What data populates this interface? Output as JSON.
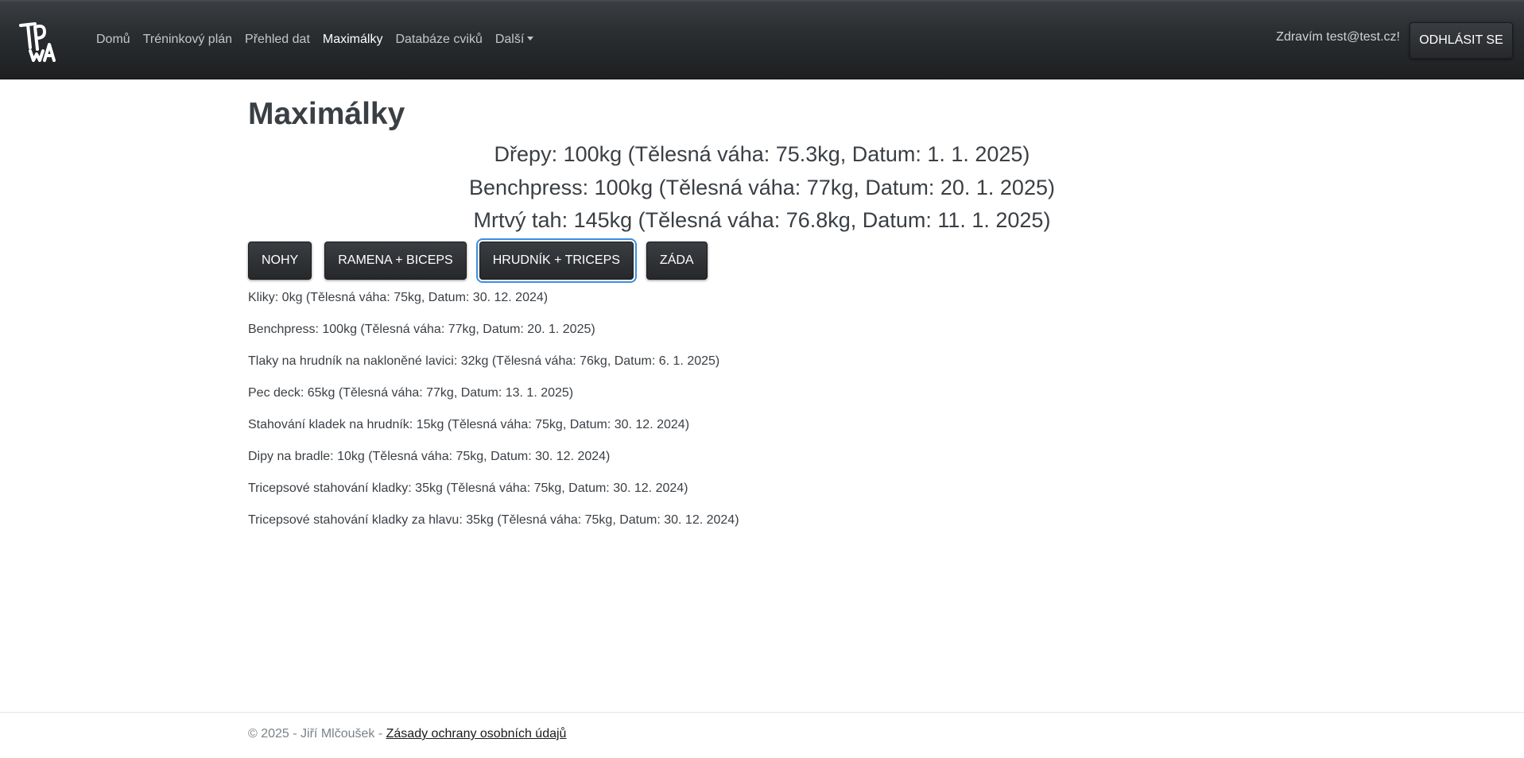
{
  "navbar": {
    "brand_alt": "TPWA",
    "links": [
      {
        "label": "Domů"
      },
      {
        "label": "Tréninkový plán"
      },
      {
        "label": "Přehled dat"
      },
      {
        "label": "Maximálky",
        "active": true
      },
      {
        "label": "Databáze cviků"
      },
      {
        "label": "Další",
        "dropdown": true
      }
    ],
    "greeting": "Zdravím test@test.cz!",
    "logout_label": "ODHLÁSIT SE"
  },
  "main": {
    "title": "Maximálky",
    "summary": [
      "Dřepy: 100kg (Tělesná váha: 75.3kg, Datum: 1. 1. 2025)",
      "Benchpress: 100kg (Tělesná váha: 77kg, Datum: 20. 1. 2025)",
      "Mrtvý tah: 145kg (Tělesná váha: 76.8kg, Datum: 11. 1. 2025)"
    ],
    "tabs": [
      {
        "label": "NOHY"
      },
      {
        "label": "RAMENA + BICEPS"
      },
      {
        "label": "HRUDNÍK + TRICEPS",
        "active": true
      },
      {
        "label": "ZÁDA"
      }
    ],
    "records": [
      "Kliky: 0kg (Tělesná váha: 75kg, Datum: 30. 12. 2024)",
      "Benchpress: 100kg (Tělesná váha: 77kg, Datum: 20. 1. 2025)",
      "Tlaky na hrudník na nakloněné lavici: 32kg (Tělesná váha: 76kg, Datum: 6. 1. 2025)",
      "Pec deck: 65kg (Tělesná váha: 77kg, Datum: 13. 1. 2025)",
      "Stahování kladek na hrudník: 15kg (Tělesná váha: 75kg, Datum: 30. 12. 2024)",
      "Dipy na bradle: 10kg (Tělesná váha: 75kg, Datum: 30. 12. 2024)",
      "Tricepsové stahování kladky: 35kg (Tělesná váha: 75kg, Datum: 30. 12. 2024)",
      "Tricepsové stahování kladky za hlavu: 35kg (Tělesná váha: 75kg, Datum: 30. 12. 2024)"
    ]
  },
  "footer": {
    "copyright": "© 2025 - Jiří Mlčoušek - ",
    "privacy_link": "Zásady ochrany osobních údajů"
  },
  "colors": {
    "navbar_bg": "#26282b",
    "active_focus_ring": "#3b8fe0",
    "text": "#3a3f44"
  }
}
